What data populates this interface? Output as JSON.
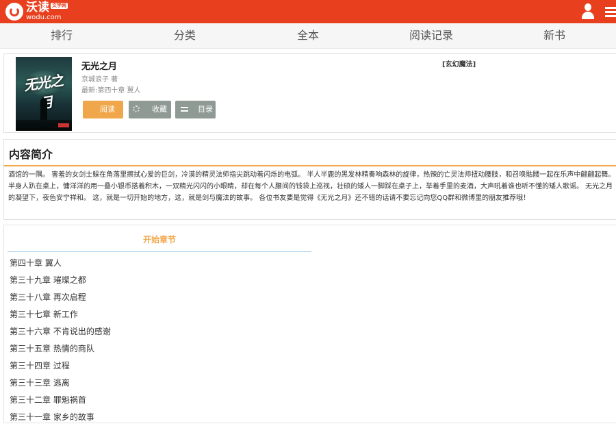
{
  "header": {
    "logo_text": "沃读",
    "logo_badge": "文学网",
    "logo_sub": "wodu.com",
    "brand_color": "#e8401e"
  },
  "nav": {
    "items": [
      "排行",
      "分类",
      "全本",
      "阅读记录",
      "新书"
    ]
  },
  "book": {
    "title": "无光之月",
    "author": "京城浪子 著",
    "latest": "最新:第四十章 翼人",
    "genre": "[玄幻魔法]",
    "cover_art_text": "无光之月",
    "buttons": {
      "read": "阅读",
      "collect": "收藏",
      "toc": "目录"
    },
    "accent_color": "#f0a74c"
  },
  "intro": {
    "heading": "内容简介",
    "text": "酒馆的一隅。 害羞的女剑士躲在角落里擦拭心爱的巨剑，冷漠的精灵法师指尖跳动着闪烁的电弧。 半人半鹿的黑发林精奏响森林的旋律，热辣的亡灵法师扭动腰肢，和召唤骷髅一起在乐声中翩翩起舞。 半身人趴在桌上，慵洋洋的用一叠小银币搭着积木，一双精光闪闪的小眼睛，却在每个人腰间的钱袋上巡视，壮硕的矮人一脚踩在桌子上，举着手里的麦酒，大声吼着谁也听不懂的矮人歌谣。 无光之月的凝望下，夜色安宁祥和。 这，就是一切开始的地方，这，就是剑与魔法的故事。 各位书友要是觉得《无光之月》还不错的话请不要忘记向您QQ群和微博里的朋友推荐哦！"
  },
  "chapters": {
    "start_label": "开始章节",
    "items": [
      "第四十章 翼人",
      "第三十九章 璀璨之都",
      "第三十八章 再次启程",
      "第三十七章 新工作",
      "第三十六章 不肯说出的感谢",
      "第三十五章 热情的商队",
      "第三十四章 过程",
      "第三十三章 逃离",
      "第三十二章 罪魁祸首",
      "第三十一章 家乡的故事"
    ]
  }
}
